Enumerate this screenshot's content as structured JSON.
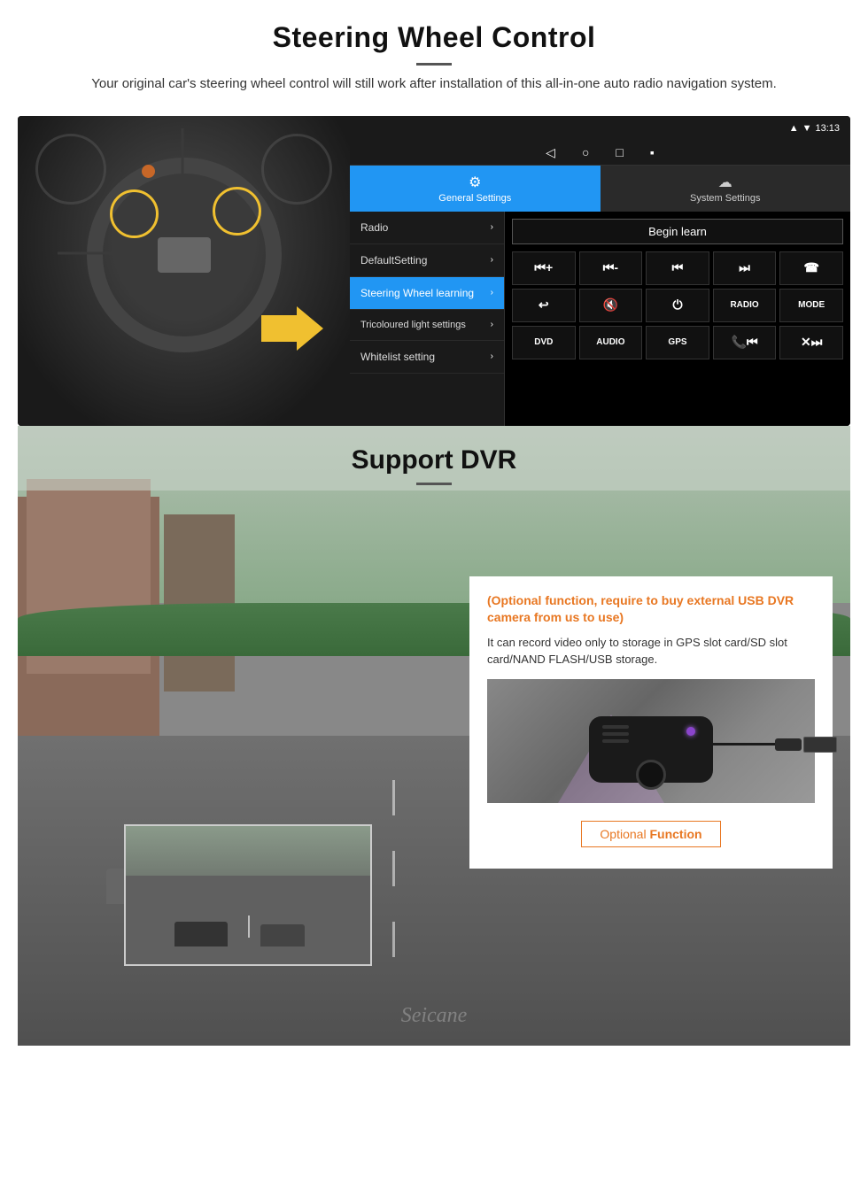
{
  "page": {
    "section1": {
      "title": "Steering Wheel Control",
      "subtitle": "Your original car's steering wheel control will still work after installation of this all-in-one auto radio navigation system.",
      "statusbar": {
        "signal": "▾",
        "wifi": "▾",
        "time": "13:13"
      },
      "tabs": [
        {
          "label": "General Settings",
          "icon": "⚙",
          "active": true
        },
        {
          "label": "System Settings",
          "icon": "☁",
          "active": false
        }
      ],
      "menu_items": [
        {
          "label": "Radio",
          "active": false
        },
        {
          "label": "DefaultSetting",
          "active": false
        },
        {
          "label": "Steering Wheel learning",
          "active": true
        },
        {
          "label": "Tricoloured light settings",
          "active": false
        },
        {
          "label": "Whitelist setting",
          "active": false
        }
      ],
      "begin_learn": "Begin learn",
      "control_buttons": {
        "row1": [
          "⏮+",
          "⏮-",
          "⏮",
          "⏭",
          "☎"
        ],
        "row2": [
          "↩",
          "🔇×",
          "⏻",
          "RADIO",
          "MODE"
        ],
        "row3": [
          "DVD",
          "AUDIO",
          "GPS",
          "📞⏮",
          "✕⏭"
        ]
      }
    },
    "section2": {
      "title": "Support DVR",
      "optional_text": "(Optional function, require to buy external USB DVR camera from us to use)",
      "desc_text": "It can record video only to storage in GPS slot card/SD slot card/NAND FLASH/USB storage.",
      "badge": {
        "optional": "Optional",
        "function": "Function"
      },
      "watermark": "Seicane"
    }
  }
}
